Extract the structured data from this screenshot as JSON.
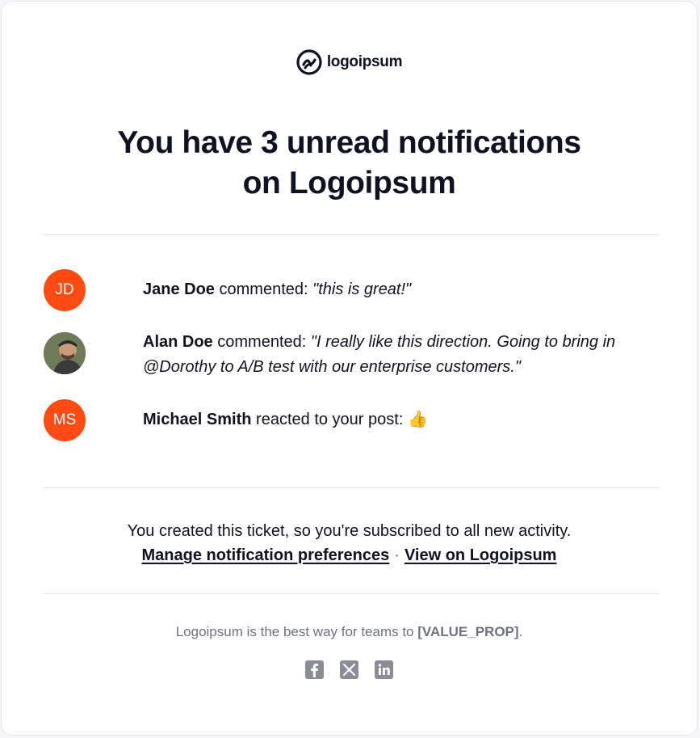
{
  "brand": {
    "name": "logoipsum"
  },
  "headline": {
    "line1": "You have 3 unread notifications",
    "line2": "on Logoipsum"
  },
  "notifications": [
    {
      "avatar_initials": "JD",
      "avatar_color": "#ff4b11",
      "actor": "Jane Doe",
      "action": "commented:",
      "content": "\"this is great!\""
    },
    {
      "avatar_initials": "",
      "avatar_type": "photo",
      "actor": "Alan Doe",
      "action": "commented:",
      "content": "\"I really like this direction. Going to bring in @Dorothy to A/B test with our enterprise customers.\""
    },
    {
      "avatar_initials": "MS",
      "avatar_color": "#ff4b11",
      "actor": "Michael Smith",
      "action": "reacted to your post:",
      "content": "👍"
    }
  ],
  "footer": {
    "message": "You created this ticket, so you're subscribed to all new activity.",
    "manage_link": "Manage notification preferences",
    "separator": "·",
    "view_link": "View on Logoipsum"
  },
  "tagline": {
    "prefix": "Logoipsum is the best way for teams to",
    "placeholder": "[VALUE_PROP]",
    "suffix": "."
  },
  "social": [
    {
      "icon": "facebook-icon"
    },
    {
      "icon": "x-icon"
    },
    {
      "icon": "linkedin-icon"
    }
  ],
  "colors": {
    "accent": "#ff4b11",
    "text": "#0f1222",
    "muted": "#6f7280"
  }
}
